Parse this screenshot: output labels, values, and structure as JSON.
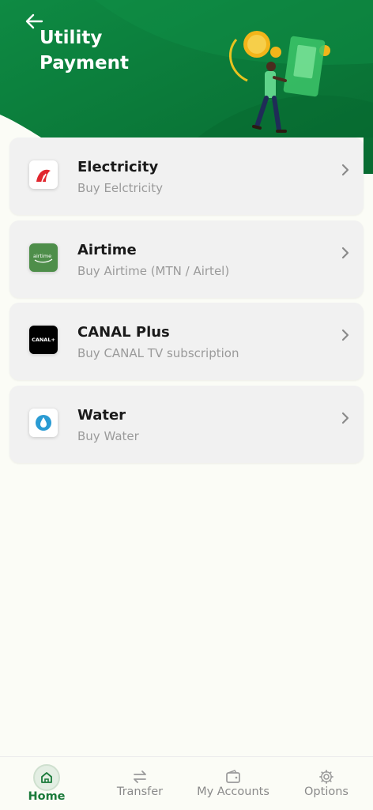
{
  "header": {
    "title": "Utility Payment",
    "illustration": "person-with-phone-and-coins-illustration"
  },
  "services": [
    {
      "name": "Electricity",
      "description": "Buy Eelctricity",
      "icon": "electricity-logo-icon",
      "logo_bg": "#ffffff"
    },
    {
      "name": "Airtime",
      "description": "Buy Airtime (MTN / Airtel)",
      "icon": "airtime-logo-icon",
      "logo_bg": "#4e8e4a",
      "logo_text": "airtime"
    },
    {
      "name": "CANAL Plus",
      "description": "Buy CANAL TV subscription",
      "icon": "canal-plus-logo-icon",
      "logo_bg": "#000000",
      "logo_text": "CANAL+"
    },
    {
      "name": "Water",
      "description": "Buy Water",
      "icon": "water-logo-icon",
      "logo_bg": "#ffffff"
    }
  ],
  "nav": [
    {
      "label": "Home",
      "icon": "home-icon",
      "active": true
    },
    {
      "label": "Transfer",
      "icon": "transfer-arrows-icon",
      "active": false
    },
    {
      "label": "My Accounts",
      "icon": "wallet-icon",
      "active": false
    },
    {
      "label": "Options",
      "icon": "gear-icon",
      "active": false
    }
  ],
  "colors": {
    "brand_green": "#0d7a3a",
    "active_nav": "#1a7a3a",
    "background": "#fbfcf6",
    "card": "#f1f1f1"
  }
}
